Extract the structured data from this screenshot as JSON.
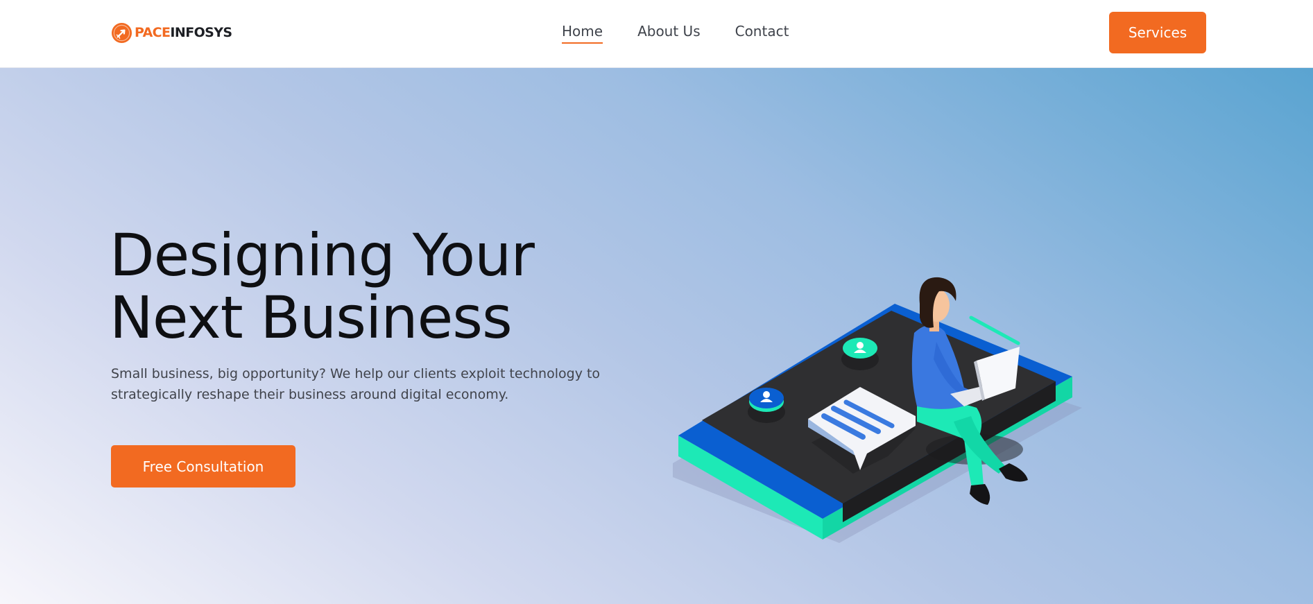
{
  "brand": {
    "name_part1": "PACE",
    "name_part2": "INFOSYS",
    "accent_color": "#f26a21"
  },
  "nav": {
    "items": [
      {
        "label": "Home",
        "active": true
      },
      {
        "label": "About Us",
        "active": false
      },
      {
        "label": "Contact",
        "active": false
      }
    ],
    "cta_label": "Services"
  },
  "hero": {
    "title_line1": "Designing Your",
    "title_line2": "Next Business",
    "subtitle": "Small business, big opportunity? We help our clients exploit technology to strategically reshape their business around digital economy.",
    "cta_label": "Free Consultation",
    "illustration": "woman-with-laptop-on-smartphone-illustration"
  },
  "colors": {
    "primary": "#f26a21",
    "dark_text": "#0e0f12",
    "body_text": "#40434b",
    "phone_blue": "#0a5fd1",
    "phone_mint": "#1de9b6",
    "phone_screen": "#2f2f31"
  }
}
